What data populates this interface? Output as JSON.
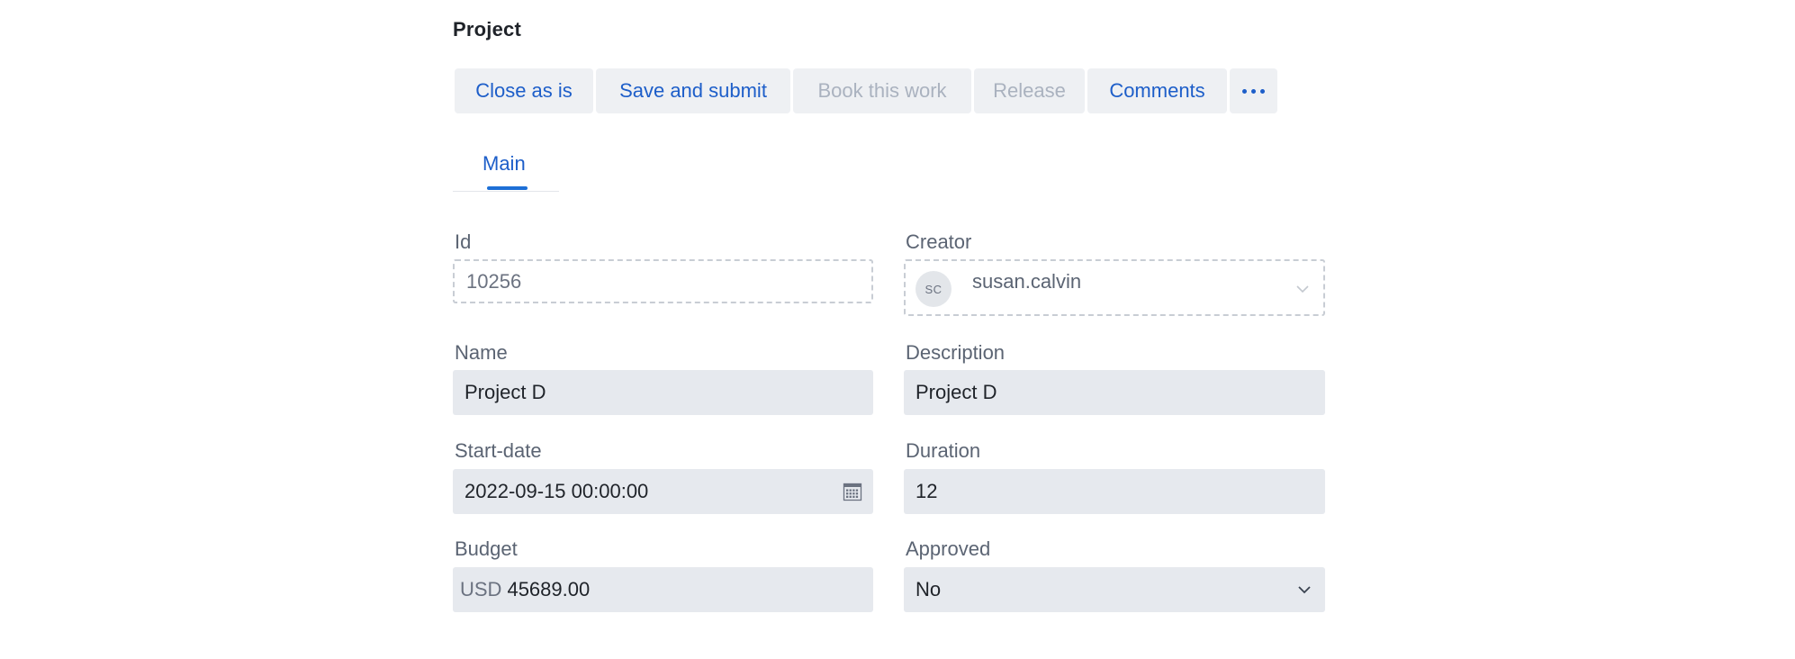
{
  "page": {
    "title": "Project"
  },
  "toolbar": {
    "buttons": [
      {
        "label": "Close as is",
        "enabled": true
      },
      {
        "label": "Save and submit",
        "enabled": true
      },
      {
        "label": "Book this work",
        "enabled": false
      },
      {
        "label": "Release",
        "enabled": false
      },
      {
        "label": "Comments",
        "enabled": true
      }
    ],
    "more_icon": "more-horizontal-icon"
  },
  "tabs": [
    {
      "label": "Main",
      "active": true
    }
  ],
  "form": {
    "id": {
      "label": "Id",
      "value": "10256"
    },
    "creator": {
      "label": "Creator",
      "initials": "SC",
      "value": "susan.calvin"
    },
    "name": {
      "label": "Name",
      "value": "Project D"
    },
    "description": {
      "label": "Description",
      "value": "Project D"
    },
    "start_date": {
      "label": "Start-date",
      "value": "2022-09-15 00:00:00",
      "icon": "calendar-icon"
    },
    "duration": {
      "label": "Duration",
      "value": "12"
    },
    "budget": {
      "label": "Budget",
      "currency": "USD",
      "value": "45689.00"
    },
    "approved": {
      "label": "Approved",
      "value": "No"
    }
  },
  "colors": {
    "accent": "#1d5ec9",
    "disabled_text": "#aab2bf",
    "field_bg": "#e6e9ee",
    "label": "#5b6473"
  }
}
